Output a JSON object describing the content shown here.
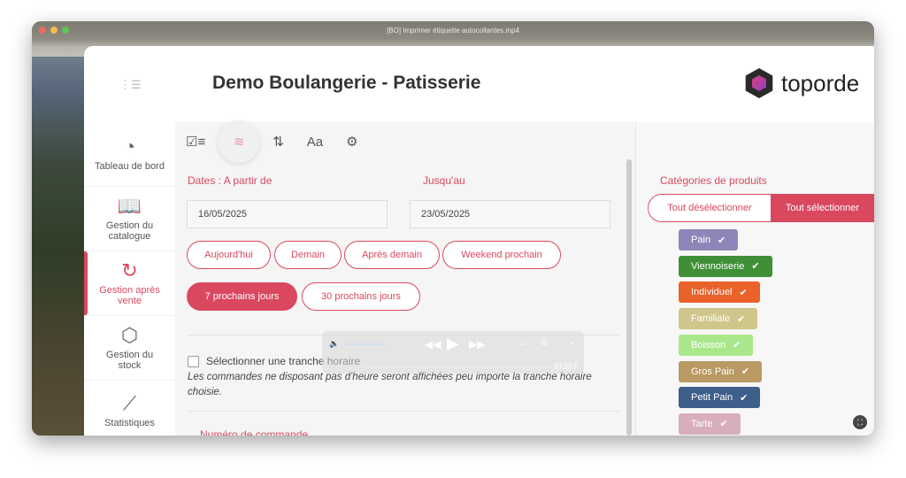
{
  "window": {
    "title": "[BO] Imprimer étiquette autocollantes.mp4"
  },
  "header": {
    "title": "Demo Boulangerie - Patisserie",
    "logo_text": "toporde"
  },
  "sidebar": {
    "items": [
      {
        "label": "Tableau de bord",
        "icon": "gauge-icon"
      },
      {
        "label": "Gestion du catalogue",
        "icon": "book-icon"
      },
      {
        "label": "Gestion après vente",
        "icon": "refresh-gear-icon",
        "active": true
      },
      {
        "label": "Gestion du stock",
        "icon": "box-icon"
      },
      {
        "label": "Statistiques",
        "icon": "chart-icon"
      }
    ]
  },
  "toolbar": {
    "icons": [
      "checklist-icon",
      "filter-sliders-icon",
      "sort-icon",
      "font-icon",
      "gears-icon"
    ]
  },
  "form": {
    "from_label": "Dates : A partir de",
    "from_value": "16/05/2025",
    "to_label": "Jusqu'au",
    "to_value": "23/05/2025",
    "quick": [
      "Aujourd'hui",
      "Demain",
      "Après demain",
      "Weekend prochain"
    ],
    "quick2": [
      "7 prochains jours",
      "30 prochains jours"
    ],
    "checkbox_label": "Sélectionner une tranche horaire",
    "note": "Les commandes ne disposant pas d'heure seront affichées peu importe la tranche horaire choisie.",
    "order_label": "Numéro de commande"
  },
  "categories": {
    "title": "Catégories de produits",
    "deselect_all": "Tout désélectionner",
    "select_all": "Tout sélectionner",
    "items": [
      {
        "label": "Pain",
        "color": "#8f85b8"
      },
      {
        "label": "Viennoiserie",
        "color": "#3f8f36"
      },
      {
        "label": "Individuel",
        "color": "#e8622a"
      },
      {
        "label": "Familiale",
        "color": "#cfc68a"
      },
      {
        "label": "Boisson",
        "color": "#a8e88a"
      },
      {
        "label": "Gros Pain",
        "color": "#b89a62"
      },
      {
        "label": "Petit Pain",
        "color": "#3d5f8a"
      },
      {
        "label": "Tarte",
        "color": "#d8aebb"
      }
    ]
  },
  "player": {
    "time": "8720 F"
  },
  "accent": "#d9485f"
}
